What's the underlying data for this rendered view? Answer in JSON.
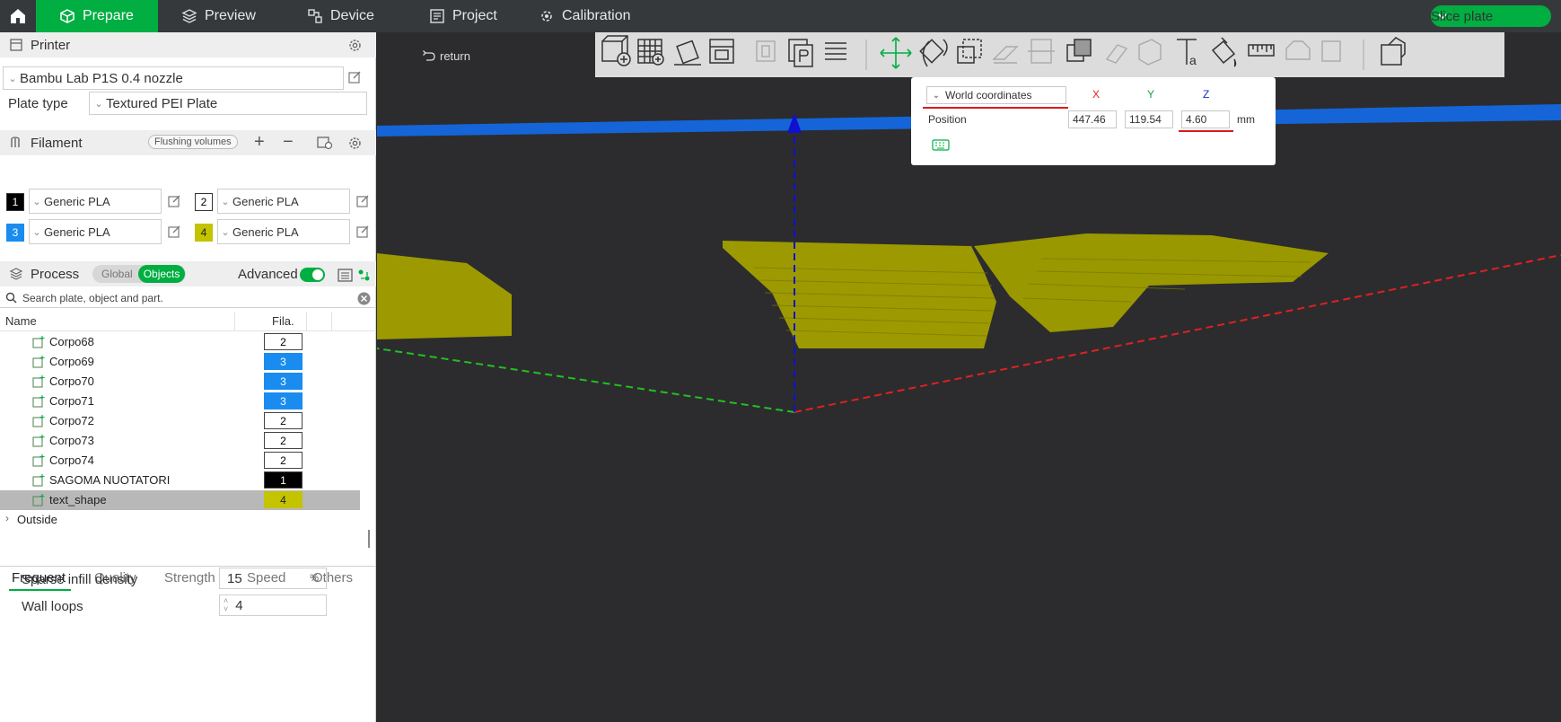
{
  "topbar": {
    "tabs": [
      {
        "label": "Prepare",
        "icon": "cube-icon"
      },
      {
        "label": "Preview",
        "icon": "preview-icon"
      },
      {
        "label": "Device",
        "icon": "device-icon"
      },
      {
        "label": "Project",
        "icon": "project-icon"
      },
      {
        "label": "Calibration",
        "icon": "calibration-icon"
      }
    ],
    "slice_label": "Slice plate",
    "accent": "#00ae42"
  },
  "printer": {
    "title": "Printer",
    "selected": "Bambu Lab P1S 0.4 nozzle",
    "plate_type_label": "Plate type",
    "plate_type": "Textured PEI Plate"
  },
  "filament": {
    "title": "Filament",
    "flushing": "Flushing volumes",
    "slots": [
      {
        "num": "1",
        "name": "Generic PLA",
        "color": "#000000"
      },
      {
        "num": "2",
        "name": "Generic PLA",
        "color": "#ffffff"
      },
      {
        "num": "3",
        "name": "Generic PLA",
        "color": "#1a8cf0"
      },
      {
        "num": "4",
        "name": "Generic PLA",
        "color": "#c3c300"
      }
    ]
  },
  "process": {
    "title": "Process",
    "global": "Global",
    "objects": "Objects",
    "advanced": "Advanced",
    "search_placeholder": "Search plate, object and part.",
    "col_name": "Name",
    "col_fila": "Fila.",
    "rows": [
      {
        "name": "Corpo68",
        "fila": "2",
        "color": "#ffffff"
      },
      {
        "name": "Corpo69",
        "fila": "3",
        "color": "#1a8cf0"
      },
      {
        "name": "Corpo70",
        "fila": "3",
        "color": "#1a8cf0"
      },
      {
        "name": "Corpo71",
        "fila": "3",
        "color": "#1a8cf0"
      },
      {
        "name": "Corpo72",
        "fila": "2",
        "color": "#ffffff"
      },
      {
        "name": "Corpo73",
        "fila": "2",
        "color": "#ffffff"
      },
      {
        "name": "Corpo74",
        "fila": "2",
        "color": "#ffffff"
      },
      {
        "name": "SAGOMA NUOTATORI",
        "fila": "1",
        "color": "#000000"
      },
      {
        "name": "text_shape",
        "fila": "4",
        "color": "#c3c300"
      }
    ],
    "outside": "Outside",
    "subtabs": [
      "Frequent",
      "Quality",
      "Strength",
      "Speed",
      "Others"
    ],
    "params": [
      {
        "label": "Sparse infill density",
        "value": "15",
        "unit": "%"
      },
      {
        "label": "Wall loops",
        "value": "4",
        "unit": ""
      }
    ]
  },
  "viewport": {
    "return": "return",
    "coord_mode": "World coordinates",
    "x_label": "X",
    "y_label": "Y",
    "z_label": "Z",
    "position_label": "Position",
    "x": "447.46",
    "y": "119.54",
    "z": "4.60",
    "unit": "mm"
  }
}
